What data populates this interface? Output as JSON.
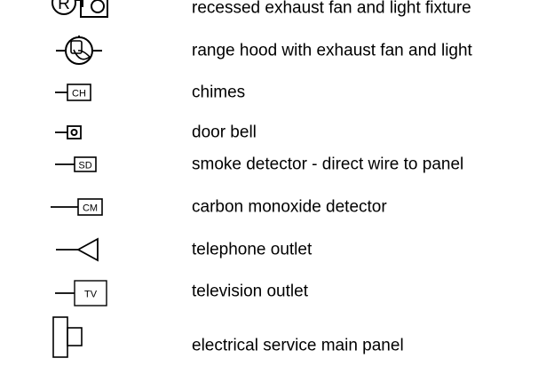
{
  "legend": {
    "items": [
      {
        "icon": "recessed-exhaust-fan-light-icon",
        "label": "recessed exhaust fan and light fixture",
        "code": "R"
      },
      {
        "icon": "range-hood-icon",
        "label": "range hood with exhaust fan and light"
      },
      {
        "icon": "chimes-icon",
        "label": "chimes",
        "code": "CH"
      },
      {
        "icon": "door-bell-icon",
        "label": "door bell"
      },
      {
        "icon": "smoke-detector-icon",
        "label": "smoke detector - direct wire to panel",
        "code": "SD"
      },
      {
        "icon": "carbon-monoxide-detector-icon",
        "label": "carbon monoxide detector",
        "code": "CM"
      },
      {
        "icon": "telephone-outlet-icon",
        "label": "telephone outlet"
      },
      {
        "icon": "television-outlet-icon",
        "label": "television outlet",
        "code": "TV"
      },
      {
        "icon": "electrical-service-panel-icon",
        "label": "electrical service main panel"
      }
    ]
  }
}
